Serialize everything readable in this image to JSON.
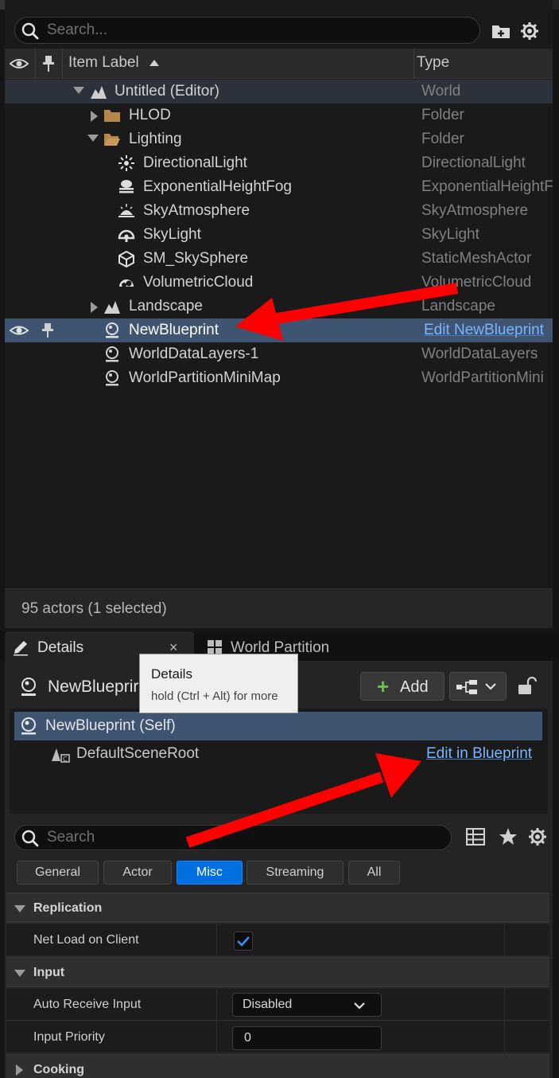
{
  "outliner": {
    "search_placeholder": "Search...",
    "header": {
      "item_label": "Item Label",
      "type": "Type"
    },
    "rows": [
      {
        "label": "Untitled (Editor)",
        "type": "World"
      },
      {
        "label": "HLOD",
        "type": "Folder"
      },
      {
        "label": "Lighting",
        "type": "Folder"
      },
      {
        "label": "DirectionalLight",
        "type": "DirectionalLight"
      },
      {
        "label": "ExponentialHeightFog",
        "type": "ExponentialHeightF"
      },
      {
        "label": "SkyAtmosphere",
        "type": "SkyAtmosphere"
      },
      {
        "label": "SkyLight",
        "type": "SkyLight"
      },
      {
        "label": "SM_SkySphere",
        "type": "StaticMeshActor"
      },
      {
        "label": "VolumetricCloud",
        "type": "VolumetricCloud"
      },
      {
        "label": "Landscape",
        "type": "Landscape"
      },
      {
        "label": "NewBlueprint",
        "type": "Edit NewBlueprint"
      },
      {
        "label": "WorldDataLayers-1",
        "type": "WorldDataLayers"
      },
      {
        "label": "WorldPartitionMiniMap",
        "type": "WorldPartitionMini"
      }
    ],
    "status": "95 actors (1 selected)"
  },
  "tabs": {
    "details": "Details",
    "close": "×",
    "world_partition": "World Partition"
  },
  "tooltip": {
    "title": "Details",
    "hint": "hold (Ctrl + Alt) for more"
  },
  "details": {
    "actor_name": "NewBlueprir",
    "add_label": "Add",
    "components": {
      "self": "NewBlueprint (Self)",
      "root": "DefaultSceneRoot",
      "edit_link": "Edit in Blueprint"
    },
    "search_placeholder": "Search",
    "filters": [
      "General",
      "Actor",
      "Misc",
      "Streaming",
      "All"
    ],
    "active_filter": "Misc",
    "sections": {
      "replication": "Replication",
      "net_load": "Net Load on Client",
      "net_load_checked": true,
      "input": "Input",
      "auto_receive": "Auto Receive Input",
      "auto_receive_value": "Disabled",
      "input_priority": "Input Priority",
      "input_priority_value": "0",
      "cooking": "Cooking"
    }
  },
  "colors": {
    "selection": "#3e5470",
    "link": "#7ab5ff",
    "accent": "#0070e0",
    "annotation_arrow": "#ff0000"
  }
}
